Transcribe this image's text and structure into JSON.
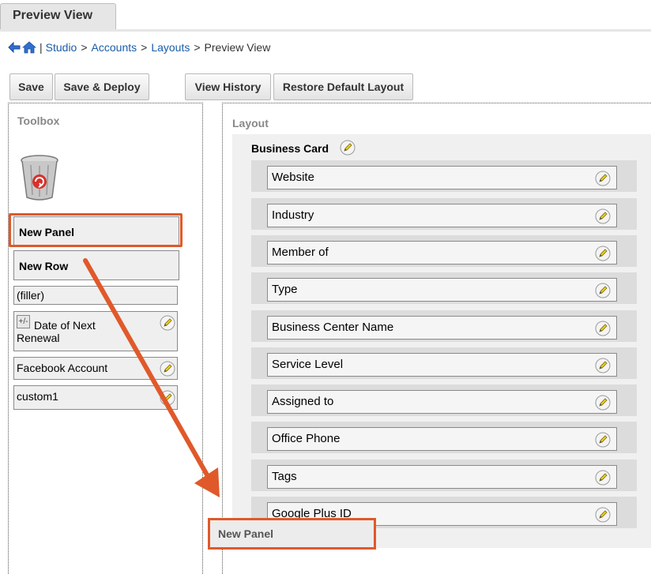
{
  "tab": {
    "label": "Preview View"
  },
  "breadcrumb": {
    "separator": "|",
    "items": [
      "Studio",
      ">",
      "Accounts",
      ">",
      "Layouts",
      ">",
      "Preview View"
    ]
  },
  "toolbar": {
    "save": "Save",
    "save_deploy": "Save & Deploy",
    "view_history": "View History",
    "restore_default": "Restore Default Layout"
  },
  "toolbox": {
    "title": "Toolbox",
    "items": [
      "New Panel",
      "New Row",
      "(filler)",
      "Date of Next Renewal",
      "Facebook Account",
      "custom1"
    ],
    "expand_glyph": "+/-"
  },
  "layout": {
    "title": "Layout",
    "panel_title": "Business Card",
    "fields": [
      "Website",
      "Industry",
      "Member of",
      "Type",
      "Business Center Name",
      "Service Level",
      "Assigned to",
      "Office Phone",
      "Tags",
      "Google Plus ID"
    ],
    "dropped_panel": "New Panel"
  },
  "colors": {
    "highlight": "#e0592a",
    "link": "#1a5ca8"
  },
  "icons": [
    "back-arrow-icon",
    "home-icon",
    "recycle-bin-icon",
    "pencil-icon",
    "expand-collapse-icon",
    "drag-arrow"
  ]
}
